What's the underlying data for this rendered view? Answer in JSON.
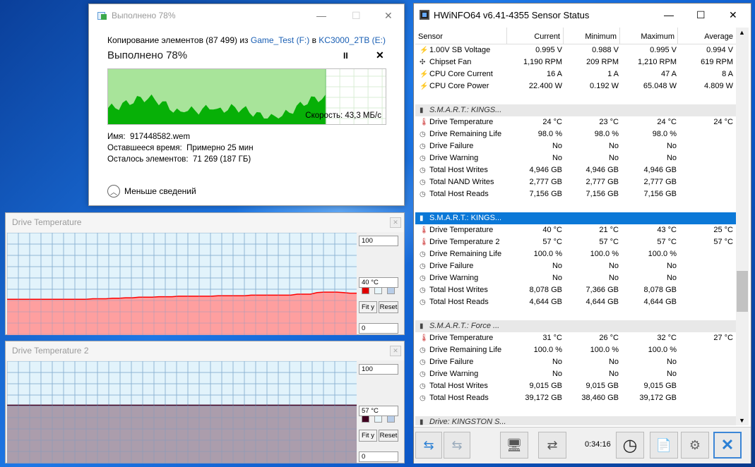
{
  "copy": {
    "title": "Выполнено 78%",
    "line_prefix": "Копирование элементов (87 499) из ",
    "src": "Game_Test (F:)",
    "mid": " в ",
    "dst": "KC3000_2TB (E:)",
    "heading": "Выполнено 78%",
    "pause": "II",
    "close": "✕",
    "progress": 0.78,
    "speed": "Скорость: 43,3 МБ/с",
    "name_label": "Имя:",
    "name_value": "917448582.wem",
    "time_label": "Оставшееся время:",
    "time_value": "Примерно 25 мин",
    "items_label": "Осталось элементов:",
    "items_value": "71 269 (187 ГБ)",
    "less": "Меньше сведений",
    "colors": {
      "fill": "#07b007",
      "bg": "#a8e49a"
    }
  },
  "dt1": {
    "title": "Drive Temperature",
    "max": "100",
    "cur": "40 °C",
    "min": "0",
    "fit": "Fit y",
    "reset": "Reset",
    "color": "#ff0000",
    "fill": "#ff9a9a",
    "value": 40,
    "series": [
      35,
      35,
      35,
      35,
      35,
      35,
      35,
      35,
      35,
      35,
      35,
      35,
      35,
      35.5,
      35.5,
      35.5,
      36,
      36,
      36.5,
      36.5,
      37,
      37,
      37,
      37.5,
      37.5,
      37.5,
      38,
      38,
      38,
      38,
      38,
      38,
      38.5,
      38.5,
      38.5,
      38.5,
      38.5,
      39,
      39,
      39,
      39,
      39,
      39,
      39,
      40,
      40,
      40,
      41.5,
      42,
      42,
      42,
      41.5,
      41,
      41
    ]
  },
  "dt2": {
    "title": "Drive Temperature 2",
    "max": "100",
    "cur": "57 °C",
    "min": "0",
    "fit": "Fit y",
    "reset": "Reset",
    "color": "#400020",
    "fill": "#a898a8",
    "value": 57
  },
  "hw": {
    "title": "HWiNFO64 v6.41-4355 Sensor Status",
    "cols": [
      "Sensor",
      "Current",
      "Minimum",
      "Maximum",
      "Average"
    ],
    "time": "0:34:16",
    "rows": [
      {
        "t": "bolt",
        "n": "1.00V SB Voltage",
        "v": [
          "0.995 V",
          "0.988 V",
          "0.995 V",
          "0.994 V"
        ]
      },
      {
        "t": "fan",
        "n": "Chipset Fan",
        "v": [
          "1,190 RPM",
          "209 RPM",
          "1,210 RPM",
          "619 RPM"
        ]
      },
      {
        "t": "bolt",
        "n": "CPU Core Current",
        "v": [
          "16 A",
          "1 A",
          "47 A",
          "8 A"
        ]
      },
      {
        "t": "bolt",
        "n": "CPU Core Power",
        "v": [
          "22.400 W",
          "0.192 W",
          "65.048 W",
          "4.809 W"
        ]
      },
      {
        "t": "blank",
        "n": "",
        "v": [
          "",
          "",
          "",
          ""
        ]
      },
      {
        "t": "grp",
        "n": "S.M.A.R.T.: KINGS...",
        "v": [
          "",
          "",
          "",
          ""
        ]
      },
      {
        "t": "therm",
        "n": "Drive Temperature",
        "v": [
          "24 °C",
          "23 °C",
          "24 °C",
          "24 °C"
        ]
      },
      {
        "t": "clock",
        "n": "Drive Remaining Life",
        "v": [
          "98.0 %",
          "98.0 %",
          "98.0 %",
          ""
        ]
      },
      {
        "t": "clock",
        "n": "Drive Failure",
        "v": [
          "No",
          "No",
          "No",
          ""
        ]
      },
      {
        "t": "clock",
        "n": "Drive Warning",
        "v": [
          "No",
          "No",
          "No",
          ""
        ]
      },
      {
        "t": "clock",
        "n": "Total Host Writes",
        "v": [
          "4,946 GB",
          "4,946 GB",
          "4,946 GB",
          ""
        ]
      },
      {
        "t": "clock",
        "n": "Total NAND Writes",
        "v": [
          "2,777 GB",
          "2,777 GB",
          "2,777 GB",
          ""
        ]
      },
      {
        "t": "clock",
        "n": "Total Host Reads",
        "v": [
          "7,156 GB",
          "7,156 GB",
          "7,156 GB",
          ""
        ]
      },
      {
        "t": "blank",
        "n": "",
        "v": [
          "",
          "",
          "",
          ""
        ]
      },
      {
        "t": "sel",
        "n": "S.M.A.R.T.: KINGS...",
        "v": [
          "",
          "",
          "",
          ""
        ]
      },
      {
        "t": "therm",
        "n": "Drive Temperature",
        "v": [
          "40 °C",
          "21 °C",
          "43 °C",
          "25 °C"
        ]
      },
      {
        "t": "therm",
        "n": "Drive Temperature 2",
        "v": [
          "57 °C",
          "57 °C",
          "57 °C",
          "57 °C"
        ]
      },
      {
        "t": "clock",
        "n": "Drive Remaining Life",
        "v": [
          "100.0 %",
          "100.0 %",
          "100.0 %",
          ""
        ]
      },
      {
        "t": "clock",
        "n": "Drive Failure",
        "v": [
          "No",
          "No",
          "No",
          ""
        ]
      },
      {
        "t": "clock",
        "n": "Drive Warning",
        "v": [
          "No",
          "No",
          "No",
          ""
        ]
      },
      {
        "t": "clock",
        "n": "Total Host Writes",
        "v": [
          "8,078 GB",
          "7,366 GB",
          "8,078 GB",
          ""
        ]
      },
      {
        "t": "clock",
        "n": "Total Host Reads",
        "v": [
          "4,644 GB",
          "4,644 GB",
          "4,644 GB",
          ""
        ]
      },
      {
        "t": "blank",
        "n": "",
        "v": [
          "",
          "",
          "",
          ""
        ]
      },
      {
        "t": "grp",
        "n": "S.M.A.R.T.: Force ...",
        "v": [
          "",
          "",
          "",
          ""
        ]
      },
      {
        "t": "therm",
        "n": "Drive Temperature",
        "v": [
          "31 °C",
          "26 °C",
          "32 °C",
          "27 °C"
        ]
      },
      {
        "t": "clock",
        "n": "Drive Remaining Life",
        "v": [
          "100.0 %",
          "100.0 %",
          "100.0 %",
          ""
        ]
      },
      {
        "t": "clock",
        "n": "Drive Failure",
        "v": [
          "No",
          "No",
          "No",
          ""
        ]
      },
      {
        "t": "clock",
        "n": "Drive Warning",
        "v": [
          "No",
          "No",
          "No",
          ""
        ]
      },
      {
        "t": "clock",
        "n": "Total Host Writes",
        "v": [
          "9,015 GB",
          "9,015 GB",
          "9,015 GB",
          ""
        ]
      },
      {
        "t": "clock",
        "n": "Total Host Reads",
        "v": [
          "39,172 GB",
          "38,460 GB",
          "39,172 GB",
          ""
        ]
      },
      {
        "t": "blank",
        "n": "",
        "v": [
          "",
          "",
          "",
          ""
        ]
      },
      {
        "t": "grp",
        "n": "Drive: KINGSTON S...",
        "v": [
          "",
          "",
          "",
          ""
        ]
      }
    ]
  }
}
